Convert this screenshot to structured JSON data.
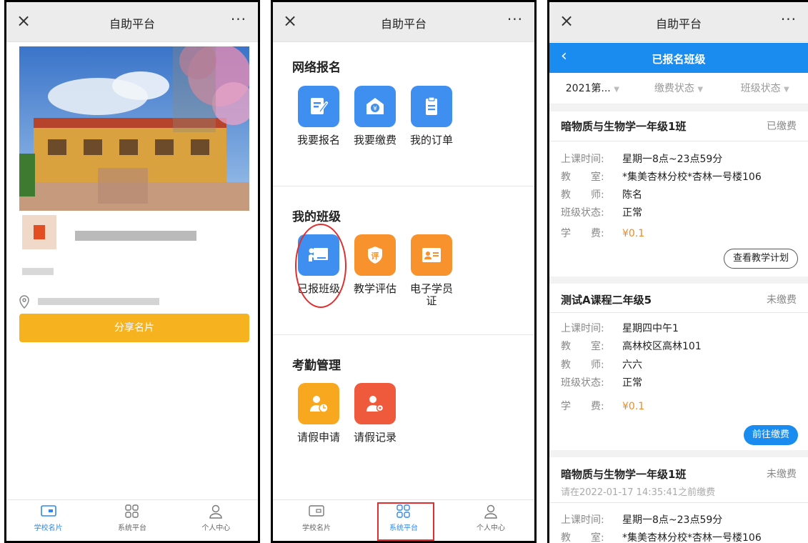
{
  "window": {
    "title": "自助平台",
    "close_glyph": "×",
    "more_glyph": "···"
  },
  "screen1": {
    "share_label": "分享名片",
    "tabs": [
      {
        "label": "学校名片",
        "icon": "card-icon",
        "active": true
      },
      {
        "label": "系统平台",
        "icon": "grid-icon",
        "active": false
      },
      {
        "label": "个人中心",
        "icon": "person-icon",
        "active": false
      }
    ]
  },
  "screen2": {
    "sections": [
      {
        "title": "网络报名",
        "apps": [
          {
            "label": "我要报名",
            "icon": "edit-icon",
            "color": "#3f8ff0"
          },
          {
            "label": "我要缴费",
            "icon": "pay-icon",
            "color": "#3f8ff0"
          },
          {
            "label": "我的订单",
            "icon": "order-icon",
            "color": "#3f8ff0"
          }
        ]
      },
      {
        "title": "我的班级",
        "apps": [
          {
            "label": "已报班级",
            "icon": "class-icon",
            "color": "#3f8ff0"
          },
          {
            "label": "教学评估",
            "icon": "evaluate-icon",
            "color": "#f7922c",
            "glyph": "评"
          },
          {
            "label": "电子学员证",
            "icon": "id-card-icon",
            "color": "#f7922c"
          }
        ]
      },
      {
        "title": "考勤管理",
        "apps": [
          {
            "label": "请假申请",
            "icon": "leave-apply-icon",
            "color": "#f7a81e"
          },
          {
            "label": "请假记录",
            "icon": "leave-record-icon",
            "color": "#ef5a3c"
          }
        ]
      }
    ],
    "tabs": [
      {
        "label": "学校名片",
        "icon": "card-icon",
        "active": false
      },
      {
        "label": "系统平台",
        "icon": "grid-icon",
        "active": true
      },
      {
        "label": "个人中心",
        "icon": "person-icon",
        "active": false
      }
    ]
  },
  "screen3": {
    "header_title": "已报名班级",
    "back_glyph": "‹",
    "filters": [
      "2021第...",
      "缴费状态",
      "班级状态"
    ],
    "labels": {
      "time": "上课时间:",
      "room": "教　　室:",
      "teacher": "教　　师:",
      "state": "班级状态:",
      "fee": "学　　费:"
    },
    "cards": [
      {
        "name": "暗物质与生物学一年级1班",
        "status": "已缴费",
        "time": "星期一8点~23点59分",
        "room": "*集美杏林分校*杏林一号楼106",
        "teacher": "陈名",
        "state": "正常",
        "fee": "¥0.1",
        "button": "查看教学计划"
      },
      {
        "name": "测试A课程二年级5",
        "status": "未缴费",
        "time": "星期四中午1",
        "room": "高林校区高林101",
        "teacher": "六六",
        "state": "正常",
        "fee": "¥0.1",
        "button": "前往缴费"
      },
      {
        "name": "暗物质与生物学一年级1班",
        "status": "未缴费",
        "hint": "请在2022-01-17 14:35:41之前缴费",
        "time": "星期一8点~23点59分",
        "room": "*集美杏林分校*杏林一号楼106"
      }
    ]
  }
}
